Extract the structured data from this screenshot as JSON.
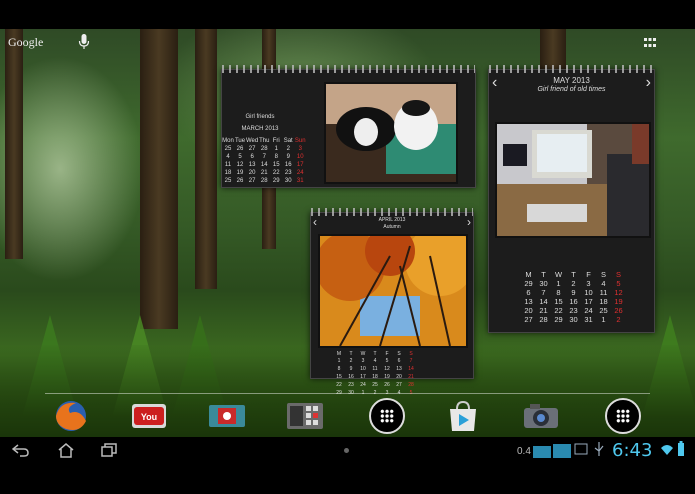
{
  "topbar": {
    "search_label": "Google"
  },
  "widget1": {
    "caption": "Girl friends",
    "month": "MARCH 2013",
    "weekdays": [
      "Mon",
      "Tue",
      "Wed",
      "Thu",
      "Fri",
      "Sat",
      "Sun"
    ],
    "weeks": [
      [
        "25",
        "26",
        "27",
        "28",
        "1",
        "2",
        "3"
      ],
      [
        "4",
        "5",
        "6",
        "7",
        "8",
        "9",
        "10"
      ],
      [
        "11",
        "12",
        "13",
        "14",
        "15",
        "16",
        "17"
      ],
      [
        "18",
        "19",
        "20",
        "21",
        "22",
        "23",
        "24"
      ],
      [
        "25",
        "26",
        "27",
        "28",
        "29",
        "30",
        "31"
      ]
    ]
  },
  "widget2": {
    "month": "APRIL 2013",
    "caption": "Autumn",
    "weekdays": [
      "M",
      "T",
      "W",
      "T",
      "F",
      "S",
      "S"
    ],
    "weeks": [
      [
        "1",
        "2",
        "3",
        "4",
        "5",
        "6",
        "7"
      ],
      [
        "8",
        "9",
        "10",
        "11",
        "12",
        "13",
        "14"
      ],
      [
        "15",
        "16",
        "17",
        "18",
        "19",
        "20",
        "21"
      ],
      [
        "22",
        "23",
        "24",
        "25",
        "26",
        "27",
        "28"
      ],
      [
        "29",
        "30",
        "1",
        "2",
        "3",
        "4",
        "5"
      ]
    ]
  },
  "widget3": {
    "month": "MAY  2013",
    "caption": "Girl friend of old times",
    "weekdays": [
      "M",
      "T",
      "W",
      "T",
      "F",
      "S",
      "S"
    ],
    "weeks": [
      [
        "29",
        "30",
        "1",
        "2",
        "3",
        "4",
        "5"
      ],
      [
        "6",
        "7",
        "8",
        "9",
        "10",
        "11",
        "12"
      ],
      [
        "13",
        "14",
        "15",
        "16",
        "17",
        "18",
        "19"
      ],
      [
        "20",
        "21",
        "22",
        "23",
        "24",
        "25",
        "26"
      ],
      [
        "27",
        "28",
        "29",
        "30",
        "31",
        "1",
        "2"
      ]
    ]
  },
  "dock": [
    "Firefox",
    "YouTube",
    "Video Player",
    "Calculator",
    "Apps",
    "Play Store",
    "Camera",
    "All Apps"
  ],
  "statusbar": {
    "battery_level": "0.4",
    "time": "6:43"
  },
  "colors": {
    "clock": "#4fc8ee",
    "sunday": "#e03030"
  }
}
